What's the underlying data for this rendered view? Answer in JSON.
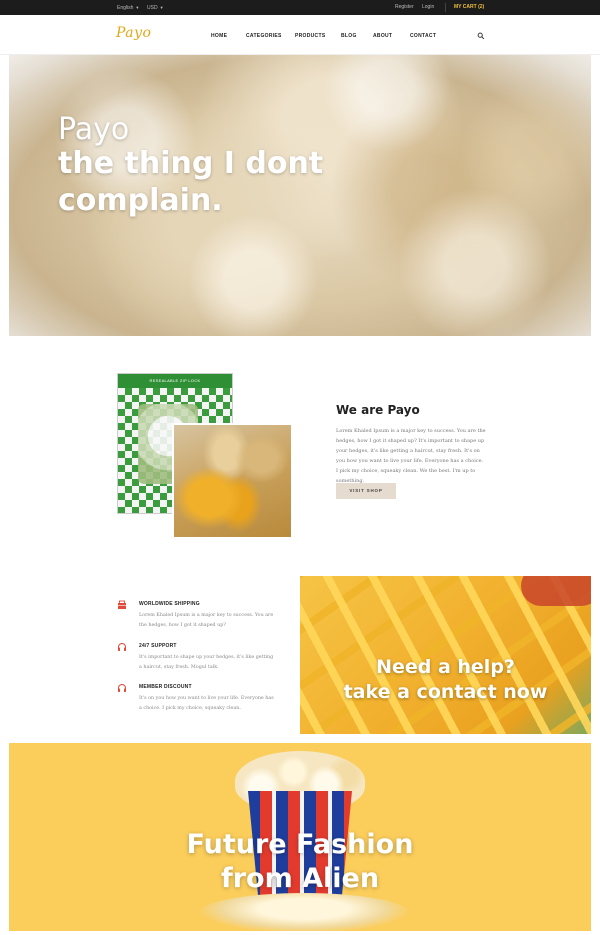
{
  "topbar": {
    "language": "English",
    "currency": "USD",
    "register": "Register",
    "login": "Login",
    "cart": "MY CART (2)"
  },
  "header": {
    "logo": "Payo",
    "nav": [
      "HOME",
      "CATEGORIES",
      "PRODUCTS",
      "BLOG",
      "ABOUT",
      "CONTACT"
    ],
    "search_icon": "search-icon"
  },
  "hero": {
    "lines": [
      "Payo",
      "the thing I dont",
      "complain."
    ]
  },
  "about": {
    "title": "We are Payo",
    "text": "Lorem Khaled Ipsum is a major key to success. You are the hedges, how I got it shaped up? It's important to shape up your hedges, it's like getting a haircut, stay fresh. It's on you how you want to live your life. Everyone has a choice. I pick my choice, squeaky clean. We the best. I'm up to something.",
    "button": "VISIT SHOP",
    "pack_label": "RESEALABLE ZIP LOCK"
  },
  "features": [
    {
      "icon": "box-icon",
      "title": "WORLDWIDE SHIPPING",
      "text": "Lorem Khaled Ipsum is a major key to success. You are the hedges, how I got it shaped up?"
    },
    {
      "icon": "headphones-icon",
      "title": "24/7 SUPPORT",
      "text": "It's important to shape up your hedges, it's like getting a haircut, stay fresh. Mogul talk."
    },
    {
      "icon": "headphones-icon",
      "title": "MEMBER DISCOUNT",
      "text": "It's on you how you want to live your life. Everyone has a choice. I pick my choice, squeaky clean."
    }
  ],
  "help": {
    "lines": [
      "Need a help?",
      "take a contact now"
    ]
  },
  "banner": {
    "lines": [
      "Future Fashion",
      "from Alien"
    ]
  },
  "colors": {
    "accent": "#f2bf3c",
    "logo": "#e0a81a",
    "icon": "#e04b3a",
    "banner_bg": "#fbcd5b",
    "button_bg": "#e5dbcf"
  }
}
